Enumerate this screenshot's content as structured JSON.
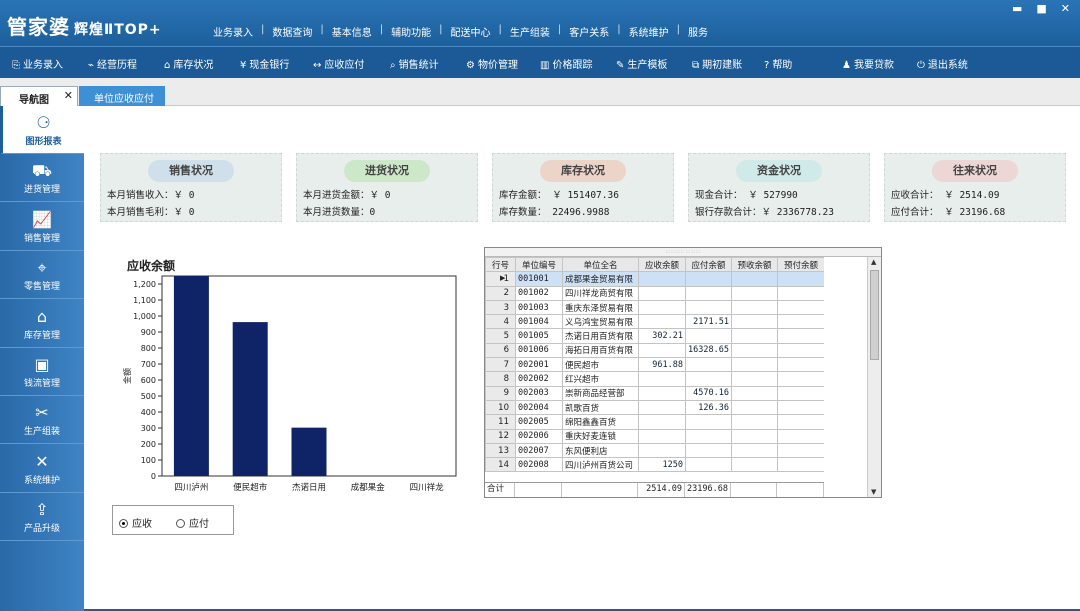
{
  "app": {
    "logo_main": "管家婆",
    "logo_sub": "辉煌ⅡTOP+",
    "menu": [
      "业务录入",
      "数据查询",
      "基本信息",
      "辅助功能",
      "配送中心",
      "生产组装",
      "客户关系",
      "系统维护",
      "服务"
    ],
    "menu_sep": "|",
    "window_controls": {
      "minimize": "▬",
      "maximize": "■",
      "close": "✕"
    }
  },
  "toolbar": {
    "items": [
      {
        "icon": "⎘",
        "label": "业务录入"
      },
      {
        "icon": "⌁",
        "label": "经营历程"
      },
      {
        "icon": "⌂",
        "label": "库存状况"
      },
      {
        "icon": "¥",
        "label": "现金银行"
      },
      {
        "icon": "↔",
        "label": "应收应付"
      },
      {
        "icon": "⌕",
        "label": "销售统计"
      },
      {
        "icon": "⚙",
        "label": "物价管理"
      },
      {
        "icon": "▥",
        "label": "价格跟踪"
      },
      {
        "icon": "✎",
        "label": "生产模板"
      },
      {
        "icon": "⧉",
        "label": "期初建账"
      },
      {
        "icon": "?",
        "label": "帮助"
      },
      {
        "icon": "♟",
        "label": "我要贷款"
      },
      {
        "icon": "⏻",
        "label": "退出系统"
      }
    ]
  },
  "tabs": {
    "nav": "导航图",
    "nav_close": "✕",
    "active": "单位应收应付"
  },
  "sidebar": {
    "items": [
      {
        "icon": "⚆",
        "label": "图形报表"
      },
      {
        "icon": "⛟",
        "label": "进货管理"
      },
      {
        "icon": "📈",
        "label": "销售管理"
      },
      {
        "icon": "⌖",
        "label": "零售管理"
      },
      {
        "icon": "⌂",
        "label": "库存管理"
      },
      {
        "icon": "▣",
        "label": "钱流管理"
      },
      {
        "icon": "✂",
        "label": "生产组装"
      },
      {
        "icon": "✕",
        "label": "系统维护"
      },
      {
        "icon": "⇪",
        "label": "产品升级"
      }
    ]
  },
  "cards": [
    {
      "title": "销售状况",
      "color": "#cfe0ea",
      "lines": [
        "本月销售收入：￥ 0",
        "本月销售毛利：￥ 0"
      ]
    },
    {
      "title": "进货状况",
      "color": "#cde7c9",
      "lines": [
        "本月进货金额：￥ 0",
        "本月进货数量：0"
      ]
    },
    {
      "title": "库存状况",
      "color": "#ecd4c8",
      "lines": [
        "库存金额： ￥ 151407.36",
        "库存数量： 22496.9988"
      ]
    },
    {
      "title": "资金状况",
      "color": "#cfeae8",
      "lines": [
        "现金合计：    ￥ 527990",
        "银行存款合计：￥ 2336778.23"
      ]
    },
    {
      "title": "往来状况",
      "color": "#ecd6d6",
      "lines": [
        "应收合计：  ￥ 2514.09",
        "应付合计：  ￥ 23196.68"
      ]
    }
  ],
  "chart_title": "应收余额",
  "chart_data": {
    "type": "bar",
    "title": "应收余额",
    "xlabel": "",
    "ylabel": "金额",
    "categories": [
      "四川泸州",
      "便民超市",
      "杰诺日用",
      "成都果金",
      "四川祥龙"
    ],
    "values": [
      1250,
      961.88,
      302.21,
      0,
      0
    ],
    "ylim": [
      0,
      1250
    ],
    "yticks": [
      0,
      100,
      200,
      300,
      400,
      500,
      600,
      700,
      800,
      900,
      1000,
      1100,
      1200
    ],
    "ytick_labels": [
      "0",
      "100",
      "200",
      "300",
      "400",
      "500",
      "600",
      "700",
      "800",
      "900",
      "1,000",
      "1,100",
      "1,200"
    ],
    "bar_color": "#0f2466",
    "grid": false
  },
  "radio": {
    "option1": "应收",
    "option2": "应付",
    "selected": "应收"
  },
  "grid": {
    "strip_text": "::::::::::: :::::::::",
    "columns": [
      "行号",
      "单位编号",
      "单位全名",
      "应收余额",
      "应付余额",
      "预收余额",
      "预付余额"
    ],
    "rows": [
      [
        "1",
        "001001",
        "成都果金贸易有限",
        "",
        "",
        "",
        ""
      ],
      [
        "2",
        "001002",
        "四川祥龙商贸有限",
        "",
        "",
        "",
        ""
      ],
      [
        "3",
        "001003",
        "重庆东泽贸易有限",
        "",
        "",
        "",
        ""
      ],
      [
        "4",
        "001004",
        "义乌鸿宝贸易有限",
        "",
        "2171.51",
        "",
        ""
      ],
      [
        "5",
        "001005",
        "杰诺日用百货有限",
        "302.21",
        "",
        "",
        ""
      ],
      [
        "6",
        "001006",
        "海拓日用百货有限",
        "",
        "16328.65",
        "",
        ""
      ],
      [
        "7",
        "002001",
        "便民超市",
        "961.88",
        "",
        "",
        ""
      ],
      [
        "8",
        "002002",
        "红兴超市",
        "",
        "",
        "",
        ""
      ],
      [
        "9",
        "002003",
        "崇新商品经营部",
        "",
        "4570.16",
        "",
        ""
      ],
      [
        "10",
        "002004",
        "凯歌百货",
        "",
        "126.36",
        "",
        ""
      ],
      [
        "11",
        "002005",
        "绵阳鑫鑫百货",
        "",
        "",
        "",
        ""
      ],
      [
        "12",
        "002006",
        "重庆好麦连锁",
        "",
        "",
        "",
        ""
      ],
      [
        "13",
        "002007",
        "东风便利店",
        "",
        "",
        "",
        ""
      ],
      [
        "14",
        "002008",
        "四川泸州百货公司",
        "1250",
        "",
        "",
        ""
      ]
    ],
    "selected_row": 0,
    "row_pointer": "▶",
    "total": {
      "label": "合计",
      "receivable": "2514.09",
      "payable": "23196.68"
    },
    "scroll_up": "▲",
    "scroll_down": "▼"
  }
}
